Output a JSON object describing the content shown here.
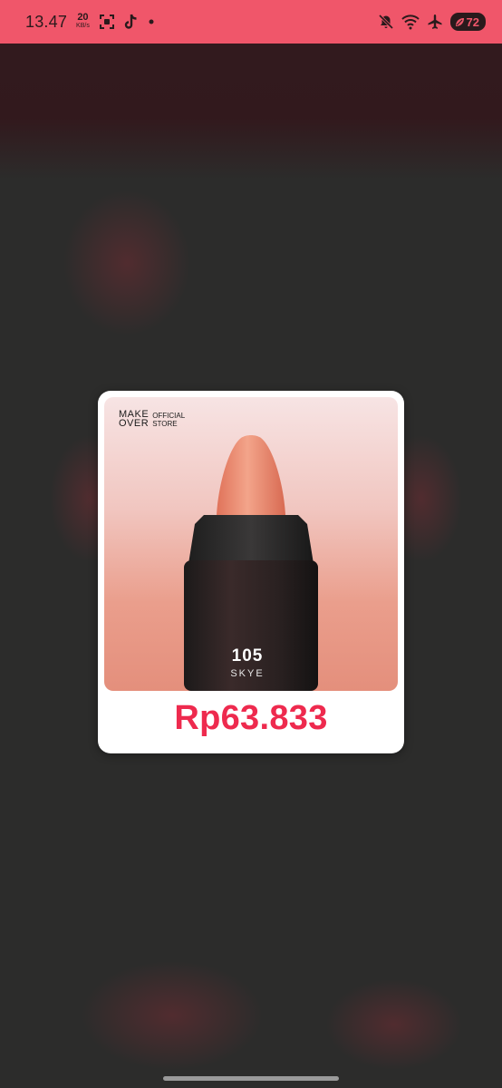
{
  "status_bar": {
    "time": "13.47",
    "net_speed_value": "20",
    "net_speed_unit": "KB/s",
    "battery_level": "72",
    "background_color": "#f0566a"
  },
  "product_card": {
    "brand_logo_line1": "MAKE",
    "brand_logo_line2": "OVER",
    "store_label_line1": "OFFICIAL",
    "store_label_line2": "STORE",
    "shade_number": "105",
    "shade_name": "SKYE",
    "price": "Rp63.833",
    "price_color": "#ee2a4e"
  },
  "icons": [
    "screenshot-icon",
    "tiktok-icon",
    "notification-dot-icon",
    "mute-icon",
    "wifi-icon",
    "airplane-mode-icon",
    "battery-saver-icon"
  ]
}
